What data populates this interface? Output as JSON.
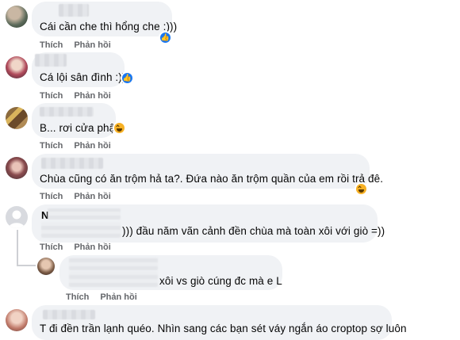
{
  "comments": [
    {
      "text": "Cái cần che thì hổng che :)))",
      "reaction": "like-icon",
      "like": "Thích",
      "reply": "Phản hồi"
    },
    {
      "text": "Cá lội sân đình :))",
      "reaction": "like-icon",
      "like": "Thích",
      "reply": "Phản hồi"
    },
    {
      "text": "B... rơi cửa phật",
      "reaction": "haha-icon",
      "like": "Thích",
      "reply": "Phản hồi"
    },
    {
      "text": "Chùa cũng có ăn trộm hả ta?. Đứa nào ăn trộm quần của em rồi trả đê.",
      "reaction": "haha-icon",
      "like": "Thích",
      "reply": "Phản hồi"
    },
    {
      "name_initial": "N",
      "text": "))) đầu năm vãn cảnh đền chùa mà toàn xôi với giò =))",
      "like": "Thích",
      "reply": "Phản hồi"
    },
    {
      "text": "xôi vs giò cúng đc mà e L",
      "like": "Thích",
      "reply": "Phản hồi"
    },
    {
      "text": "T đi đền trần lạnh quéo. Nhìn sang các bạn sét váy ngắn áo croptop sợ luôn"
    }
  ],
  "colors": {
    "bubble": "#f0f2f5",
    "action_text": "#65676b",
    "like_blue": "#1877f2",
    "haha_yellow": "#f7b125"
  }
}
